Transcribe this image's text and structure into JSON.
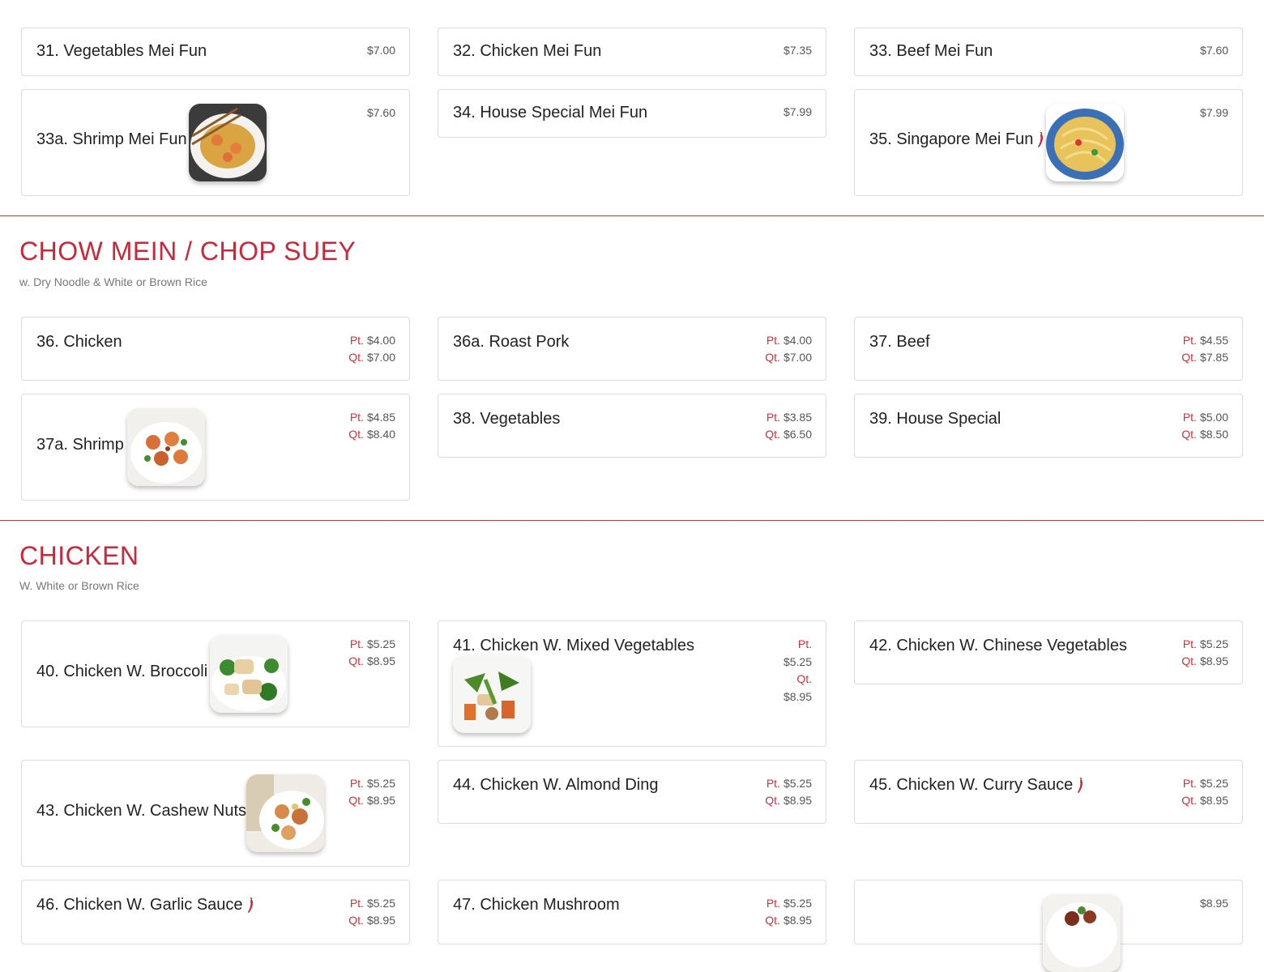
{
  "colors": {
    "accent": "#c8283a",
    "price_label": "#d0323a",
    "border": "#dcdcdc"
  },
  "mei_fun": {
    "items": [
      {
        "name": "31. Vegetables Mei Fun",
        "price": "$7.00"
      },
      {
        "name": "32. Chicken Mei Fun",
        "price": "$7.35"
      },
      {
        "name": "33. Beef Mei Fun",
        "price": "$7.60"
      },
      {
        "name": "33a. Shrimp Mei Fun",
        "price": "$7.60"
      },
      {
        "name": "34. House Special Mei Fun",
        "price": "$7.99"
      },
      {
        "name": "35. Singapore Mei Fun",
        "price": "$7.99",
        "spicy": true
      }
    ]
  },
  "chow_mein": {
    "title": "CHOW MEIN / CHOP SUEY",
    "subtitle": "w. Dry Noodle & White or Brown Rice",
    "items": [
      {
        "name": "36. Chicken",
        "pt": "$4.00",
        "qt": "$7.00"
      },
      {
        "name": "36a. Roast Pork",
        "pt": "$4.00",
        "qt": "$7.00"
      },
      {
        "name": "37. Beef",
        "pt": "$4.55",
        "qt": "$7.85"
      },
      {
        "name": "37a. Shrimp",
        "pt": "$4.85",
        "qt": "$8.40"
      },
      {
        "name": "38. Vegetables",
        "pt": "$3.85",
        "qt": "$6.50"
      },
      {
        "name": "39. House Special",
        "pt": "$5.00",
        "qt": "$8.50"
      }
    ]
  },
  "chicken": {
    "title": "CHICKEN",
    "subtitle": "W. White or Brown Rice",
    "items": [
      {
        "name": "40. Chicken W. Broccoli",
        "pt": "$5.25",
        "qt": "$8.95"
      },
      {
        "name": "41. Chicken W. Mixed Vegetables",
        "pt": "$5.25",
        "qt": "$8.95"
      },
      {
        "name": "42. Chicken W. Chinese Vegetables",
        "pt": "$5.25",
        "qt": "$8.95"
      },
      {
        "name": "43. Chicken W. Cashew Nuts",
        "pt": "$5.25",
        "qt": "$8.95"
      },
      {
        "name": "44. Chicken W. Almond Ding",
        "pt": "$5.25",
        "qt": "$8.95"
      },
      {
        "name": "45. Chicken W. Curry Sauce",
        "pt": "$5.25",
        "qt": "$8.95",
        "spicy": true
      },
      {
        "name": "46. Chicken W. Garlic Sauce",
        "pt": "$5.25",
        "qt": "$8.95",
        "spicy": true
      },
      {
        "name": "47. Chicken Mushroom",
        "pt": "$5.25",
        "qt": "$8.95"
      },
      {
        "name": "",
        "price": "$8.95"
      }
    ]
  },
  "labels": {
    "pt": "Pt.",
    "qt": "Qt."
  }
}
